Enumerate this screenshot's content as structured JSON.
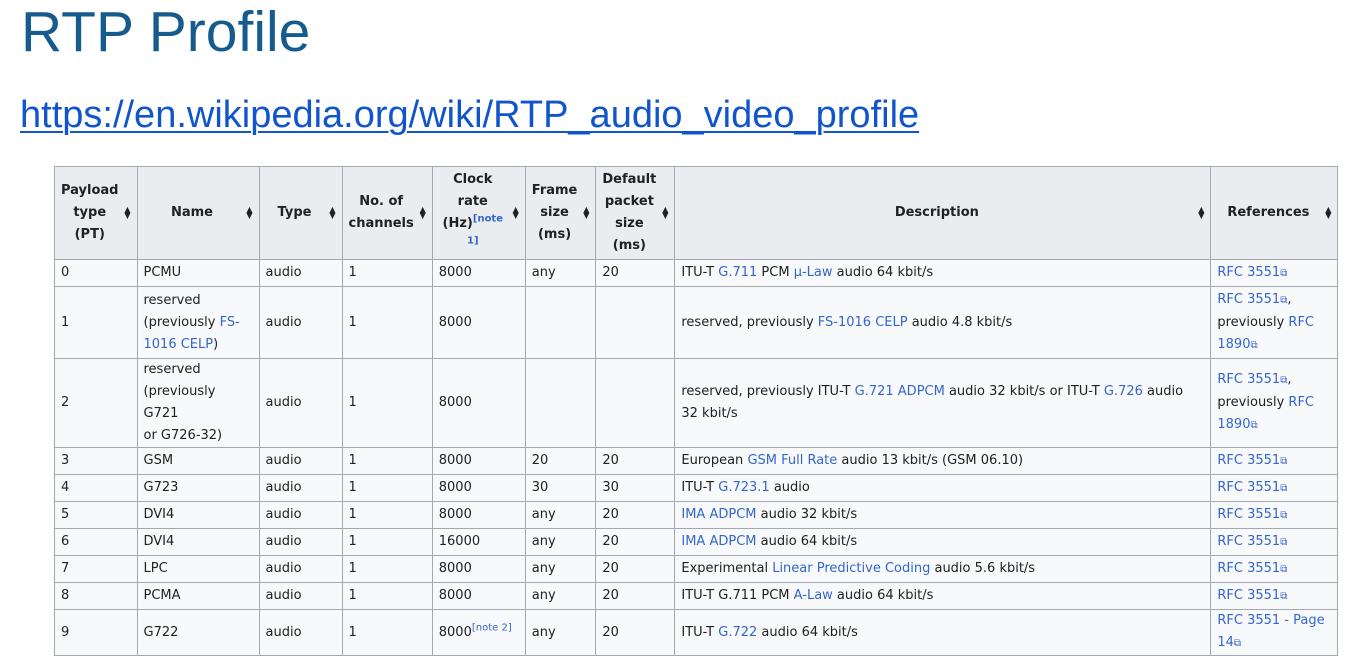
{
  "slide": {
    "title": "RTP Profile",
    "url": "https://en.wikipedia.org/wiki/RTP_audio_video_profile"
  },
  "table": {
    "headers": {
      "pt": [
        "Payload",
        "type",
        "(PT)"
      ],
      "name": "Name",
      "type": "Type",
      "channels": [
        "No. of",
        "channels"
      ],
      "clock": [
        "Clock",
        "rate",
        "(Hz)"
      ],
      "clock_note": "[note 1]",
      "frame": [
        "Frame",
        "size",
        "(ms)"
      ],
      "packet": [
        "Default",
        "packet",
        "size",
        "(ms)"
      ],
      "description": "Description",
      "references": "References"
    },
    "ext_icon": "⧉",
    "rows": [
      {
        "pt": "0",
        "name": "PCMU",
        "type": "audio",
        "channels": "1",
        "clock": "8000",
        "frame": "any",
        "packet": "20",
        "desc": [
          {
            "t": "ITU-T "
          },
          {
            "t": "G.711",
            "link": true
          },
          {
            "t": " PCM "
          },
          {
            "t": "μ-Law",
            "link": true
          },
          {
            "t": " audio 64 kbit/s"
          }
        ],
        "refs": [
          {
            "t": "RFC 3551",
            "link": true,
            "ext": true
          }
        ]
      },
      {
        "pt": "1",
        "name": [
          {
            "t": "reserved"
          },
          {
            "br": true
          },
          {
            "t": "(previously "
          },
          {
            "t": "FS-",
            "link": true
          },
          {
            "br": true
          },
          {
            "t": "1016 CELP",
            "link": true
          },
          {
            "t": ")"
          }
        ],
        "type": "audio",
        "channels": "1",
        "clock": "8000",
        "frame": "",
        "packet": "",
        "desc": [
          {
            "t": "reserved, previously "
          },
          {
            "t": "FS-1016 CELP",
            "link": true
          },
          {
            "t": " audio 4.8 kbit/s"
          }
        ],
        "refs": [
          {
            "t": "RFC 3551",
            "link": true,
            "ext": true
          },
          {
            "t": ","
          },
          {
            "br": true
          },
          {
            "t": "previously "
          },
          {
            "t": "RFC",
            "link": true
          },
          {
            "br": true
          },
          {
            "t": "1890",
            "link": true,
            "ext": true
          }
        ]
      },
      {
        "pt": "2",
        "name": [
          {
            "t": "reserved"
          },
          {
            "br": true
          },
          {
            "t": "(previously G721"
          },
          {
            "br": true
          },
          {
            "t": "or G726-32)"
          }
        ],
        "type": "audio",
        "channels": "1",
        "clock": "8000",
        "frame": "",
        "packet": "",
        "desc": [
          {
            "t": "reserved, previously ITU-T "
          },
          {
            "t": "G.721 ADPCM",
            "link": true
          },
          {
            "t": " audio 32 kbit/s or ITU-T "
          },
          {
            "t": "G.726",
            "link": true
          },
          {
            "t": " audio"
          },
          {
            "br": true
          },
          {
            "t": "32 kbit/s"
          }
        ],
        "refs": [
          {
            "t": "RFC 3551",
            "link": true,
            "ext": true
          },
          {
            "t": ","
          },
          {
            "br": true
          },
          {
            "t": "previously "
          },
          {
            "t": "RFC",
            "link": true
          },
          {
            "br": true
          },
          {
            "t": "1890",
            "link": true,
            "ext": true
          }
        ]
      },
      {
        "pt": "3",
        "name": "GSM",
        "type": "audio",
        "channels": "1",
        "clock": "8000",
        "frame": "20",
        "packet": "20",
        "desc": [
          {
            "t": "European "
          },
          {
            "t": "GSM Full Rate",
            "link": true
          },
          {
            "t": " audio 13 kbit/s (GSM 06.10)"
          }
        ],
        "refs": [
          {
            "t": "RFC 3551",
            "link": true,
            "ext": true
          }
        ]
      },
      {
        "pt": "4",
        "name": "G723",
        "type": "audio",
        "channels": "1",
        "clock": "8000",
        "frame": "30",
        "packet": "30",
        "desc": [
          {
            "t": "ITU-T "
          },
          {
            "t": "G.723.1",
            "link": true
          },
          {
            "t": " audio"
          }
        ],
        "refs": [
          {
            "t": "RFC 3551",
            "link": true,
            "ext": true
          }
        ]
      },
      {
        "pt": "5",
        "name": "DVI4",
        "type": "audio",
        "channels": "1",
        "clock": "8000",
        "frame": "any",
        "packet": "20",
        "desc": [
          {
            "t": "IMA ADPCM",
            "link": true
          },
          {
            "t": " audio 32 kbit/s"
          }
        ],
        "refs": [
          {
            "t": "RFC 3551",
            "link": true,
            "ext": true
          }
        ]
      },
      {
        "pt": "6",
        "name": "DVI4",
        "type": "audio",
        "channels": "1",
        "clock": "16000",
        "frame": "any",
        "packet": "20",
        "desc": [
          {
            "t": "IMA ADPCM",
            "link": true
          },
          {
            "t": " audio 64 kbit/s"
          }
        ],
        "refs": [
          {
            "t": "RFC 3551",
            "link": true,
            "ext": true
          }
        ]
      },
      {
        "pt": "7",
        "name": "LPC",
        "type": "audio",
        "channels": "1",
        "clock": "8000",
        "frame": "any",
        "packet": "20",
        "desc": [
          {
            "t": "Experimental "
          },
          {
            "t": "Linear Predictive Coding",
            "link": true
          },
          {
            "t": " audio 5.6 kbit/s"
          }
        ],
        "refs": [
          {
            "t": "RFC 3551",
            "link": true,
            "ext": true
          }
        ]
      },
      {
        "pt": "8",
        "name": "PCMA",
        "type": "audio",
        "channels": "1",
        "clock": "8000",
        "frame": "any",
        "packet": "20",
        "desc": [
          {
            "t": "ITU-T G.711 PCM "
          },
          {
            "t": "A-Law",
            "link": true
          },
          {
            "t": " audio 64 kbit/s"
          }
        ],
        "refs": [
          {
            "t": "RFC 3551",
            "link": true,
            "ext": true
          }
        ]
      },
      {
        "pt": "9",
        "name": "G722",
        "type": "audio",
        "channels": "1",
        "clock": "8000",
        "clock_note": "[note 2]",
        "frame": "any",
        "packet": "20",
        "desc": [
          {
            "t": "ITU-T "
          },
          {
            "t": "G.722",
            "link": true
          },
          {
            "t": " audio 64 kbit/s"
          }
        ],
        "refs": [
          {
            "t": "RFC 3551 - Page",
            "link": true
          },
          {
            "br": true
          },
          {
            "t": "14",
            "link": true,
            "ext": true
          }
        ]
      }
    ]
  }
}
